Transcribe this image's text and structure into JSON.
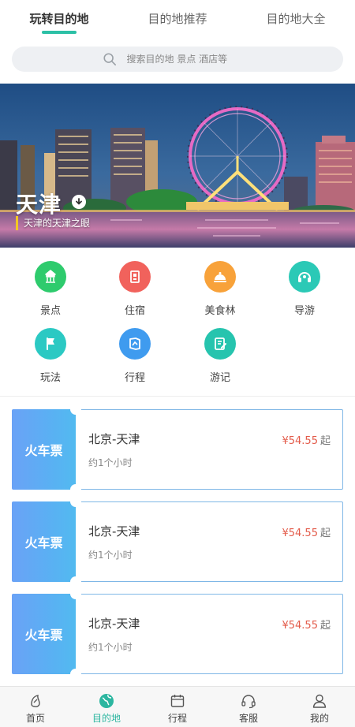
{
  "tabs": [
    {
      "label": "玩转目的地",
      "active": true
    },
    {
      "label": "目的地推荐",
      "active": false
    },
    {
      "label": "目的地大全",
      "active": false
    }
  ],
  "search": {
    "placeholder": "搜索目的地 景点 酒店等",
    "icon": "search-icon"
  },
  "banner": {
    "city": "天津",
    "subtitle": "天津的天津之眼",
    "badge_icon": "download-icon"
  },
  "categories": [
    {
      "label": "景点",
      "icon": "landmark-icon",
      "color": "#2ecb6d"
    },
    {
      "label": "住宿",
      "icon": "hotel-icon",
      "color": "#f1625c"
    },
    {
      "label": "美食林",
      "icon": "food-cloche-icon",
      "color": "#f8a23a"
    },
    {
      "label": "导游",
      "icon": "guide-headset-icon",
      "color": "#2bc9b6"
    },
    {
      "label": "玩法",
      "icon": "flag-icon",
      "color": "#2bc9c3"
    },
    {
      "label": "行程",
      "icon": "itinerary-icon",
      "color": "#3f9bef"
    },
    {
      "label": "游记",
      "icon": "travel-notes-icon",
      "color": "#26c4ae"
    }
  ],
  "tickets": [
    {
      "type": "火车票",
      "route": "北京-天津",
      "duration": "约1个小时",
      "price": "¥54.55",
      "price_suffix": "起"
    },
    {
      "type": "火车票",
      "route": "北京-天津",
      "duration": "约1个小时",
      "price": "¥54.55",
      "price_suffix": "起"
    },
    {
      "type": "火车票",
      "route": "北京-天津",
      "duration": "约1个小时",
      "price": "¥54.55",
      "price_suffix": "起"
    }
  ],
  "bottom_nav": [
    {
      "label": "首页",
      "icon": "home-icon",
      "active": false
    },
    {
      "label": "目的地",
      "icon": "globe-icon",
      "active": true
    },
    {
      "label": "行程",
      "icon": "calendar-icon",
      "active": false
    },
    {
      "label": "客服",
      "icon": "headset-icon",
      "active": false
    },
    {
      "label": "我的",
      "icon": "user-icon",
      "active": false
    }
  ],
  "colors": {
    "accent": "#2cc0a6",
    "price": "#e35b4a",
    "ticket_blue": "#5ab0f3"
  }
}
